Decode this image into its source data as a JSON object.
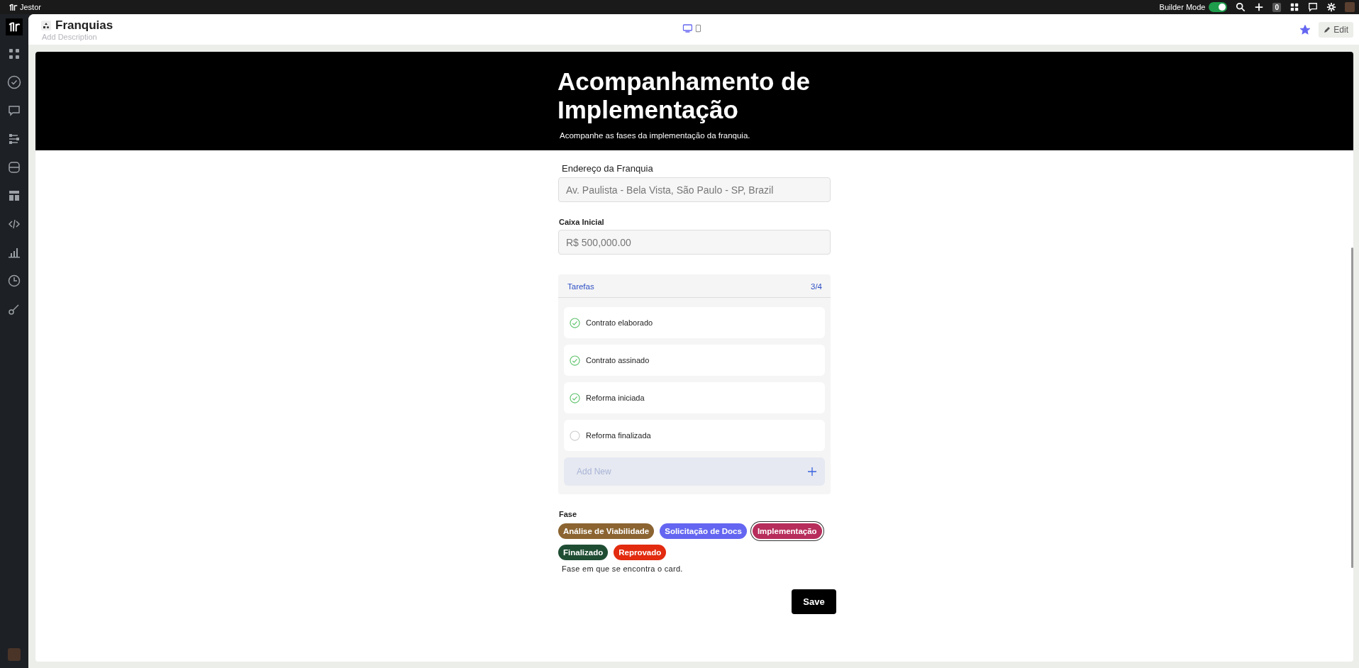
{
  "app": {
    "name": "Jestor"
  },
  "topbar": {
    "builder_mode": {
      "label": "Builder Mode",
      "on": true
    },
    "badge": "0"
  },
  "header": {
    "title": "Franquias",
    "description_placeholder": "Add Description",
    "devices": [
      {
        "kind": "desktop",
        "selected": true
      },
      {
        "kind": "mobile",
        "selected": false
      }
    ],
    "favorite": true,
    "edit_label": "Edit"
  },
  "banner": {
    "title": "Acompanhamento de Implementação",
    "subtitle": "Acompanhe as fases da implementação da franquia."
  },
  "fields": [
    {
      "kind": "text",
      "label": "Endereço da Franquia",
      "value": "Av. Paulista - Bela Vista, São Paulo - SP, Brazil"
    },
    {
      "kind": "currency",
      "label": "Caixa Inicial",
      "value": "R$ 500,000.00"
    }
  ],
  "tasks": {
    "title": "Tarefas",
    "count": "3/4",
    "items": [
      {
        "label": "Contrato elaborado",
        "checked": true
      },
      {
        "label": "Contrato assinado",
        "checked": true
      },
      {
        "label": "Reforma iniciada",
        "checked": true
      },
      {
        "label": "Reforma finalizada",
        "checked": false
      }
    ],
    "add_placeholder": "Add New"
  },
  "phase": {
    "label": "Fase",
    "options": [
      {
        "label": "Análise de Viabilidade",
        "color": "#8b6431",
        "selected": false
      },
      {
        "label": "Solicitação de Docs",
        "color": "#6466f1",
        "selected": false
      },
      {
        "label": "Implementação",
        "color": "#b72d5b",
        "selected": true
      },
      {
        "label": "Finalizado",
        "color": "#1f4d33",
        "selected": false
      },
      {
        "label": "Reprovado",
        "color": "#e22b0f",
        "selected": false
      }
    ],
    "help": "Fase em que se encontra o card."
  },
  "save_label": "Save"
}
